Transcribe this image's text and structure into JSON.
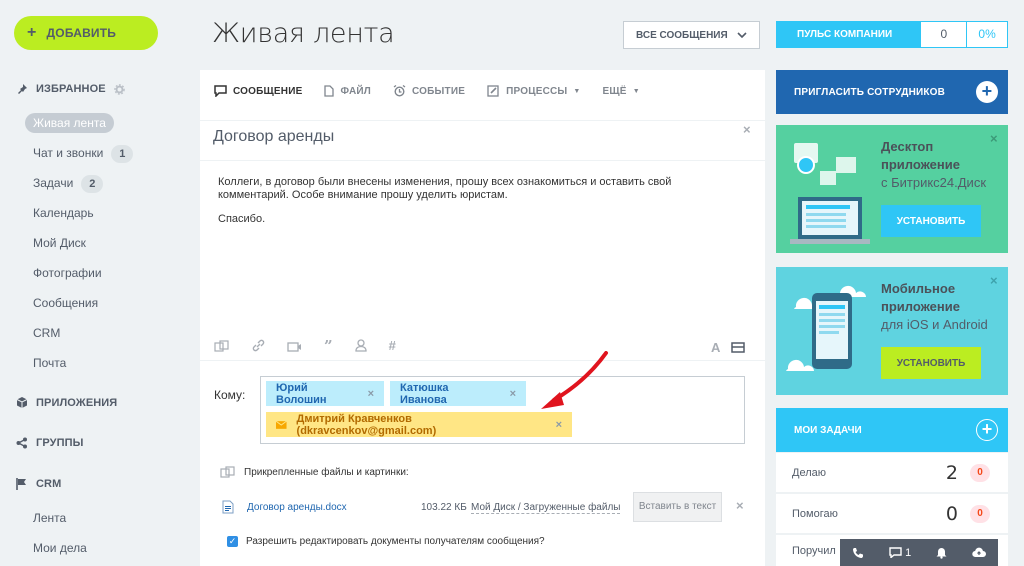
{
  "sidebar": {
    "add_label": "ДОБАВИТЬ",
    "favorites_title": "ИЗБРАННОЕ",
    "items": [
      {
        "label": "Живая лента",
        "badge": ""
      },
      {
        "label": "Чат и звонки",
        "badge": "1"
      },
      {
        "label": "Задачи",
        "badge": "2"
      },
      {
        "label": "Календарь",
        "badge": ""
      },
      {
        "label": "Мой Диск",
        "badge": ""
      },
      {
        "label": "Фотографии",
        "badge": ""
      },
      {
        "label": "Сообщения",
        "badge": ""
      },
      {
        "label": "CRM",
        "badge": ""
      },
      {
        "label": "Почта",
        "badge": ""
      }
    ],
    "apps_title": "ПРИЛОЖЕНИЯ",
    "groups_title": "ГРУППЫ",
    "crm_title": "CRM",
    "crm_items": [
      "Лента",
      "Мои дела"
    ]
  },
  "header": {
    "title": "Живая лента",
    "filter_label": "ВСЕ СООБЩЕНИЯ",
    "pulse_label": "ПУЛЬС КОМПАНИИ",
    "pulse_value": "0",
    "pulse_percent": "0%"
  },
  "composer": {
    "tabs": [
      "СООБЩЕНИЕ",
      "ФАЙЛ",
      "СОБЫТИЕ",
      "ПРОЦЕССЫ",
      "ЕЩЁ"
    ],
    "subject": "Договор аренды",
    "body_line1": "Коллеги, в договор были внесены изменения, прошу всех ознакомиться и оставить свой",
    "body_line2": "комментарий. Особе внимание прошу уделить юристам.",
    "body_line3": "Спасибо.",
    "to_label": "Кому:",
    "recipients": [
      "Юрий Волошин",
      "Катюшка Иванова",
      "Дмитрий Кравченков (dkravcenkov@gmail.com)"
    ],
    "attached_label": "Прикрепленные файлы и картинки:",
    "file_name": "Договор аренды.docx",
    "file_size": "103.22 КБ",
    "file_path": "Мой Диск / Загруженные файлы",
    "insert_label": "Вставить в текст",
    "allow_edit_label": "Разрешить редактировать документы получателям сообщения?"
  },
  "right": {
    "invite_label": "ПРИГЛАСИТЬ СОТРУДНИКОВ",
    "desktop": {
      "title1": "Десктоп",
      "title2": "приложение",
      "sub": "с Битрикс24.Диск",
      "button": "УСТАНОВИТЬ"
    },
    "mobile": {
      "title1": "Мобильное",
      "title2": "приложение",
      "sub": "для iOS и Android",
      "button": "УСТАНОВИТЬ"
    },
    "tasks_title": "МОИ ЗАДАЧИ",
    "tasks": [
      {
        "label": "Делаю",
        "value": "2",
        "count": "0"
      },
      {
        "label": "Помогаю",
        "value": "0",
        "count": "0"
      },
      {
        "label": "Поручил",
        "value": "",
        "count": ""
      }
    ]
  },
  "dock": {
    "chat_count": "1"
  },
  "colors": {
    "accent_green": "#bbed21",
    "accent_blue": "#2fc6f6",
    "dark_blue": "#2067b0",
    "promo_green": "#55d0a0",
    "promo_cyan": "#5fd3e0",
    "arrow_red": "#e0141e"
  }
}
